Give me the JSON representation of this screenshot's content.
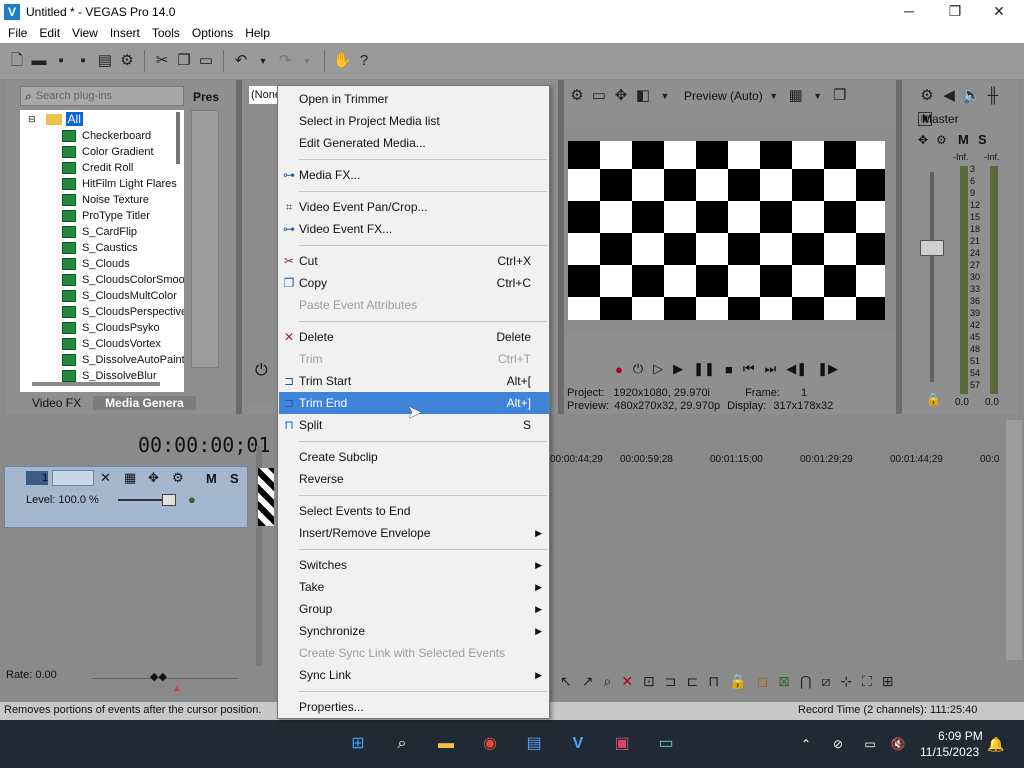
{
  "window": {
    "title": "Untitled * - VEGAS Pro 14.0",
    "logo_glyph": "V",
    "minimize": "─",
    "maximize": "❐",
    "close": "✕"
  },
  "menu": [
    "File",
    "Edit",
    "View",
    "Insert",
    "Tools",
    "Options",
    "Help"
  ],
  "plugins": {
    "search_placeholder": "Search plug-ins",
    "presets_label": "Pres",
    "root": "All",
    "items": [
      "Checkerboard",
      "Color Gradient",
      "Credit Roll",
      "HitFilm Light Flares",
      "Noise Texture",
      "ProType Titler",
      "S_CardFlip",
      "S_Caustics",
      "S_Clouds",
      "S_CloudsColorSmooth",
      "S_CloudsMultColor",
      "S_CloudsPerspective",
      "S_CloudsPsyko",
      "S_CloudsVortex",
      "S_DissolveAutoPaint",
      "S_DissolveBlur"
    ],
    "tabs": [
      "Video FX",
      "Media Genera"
    ]
  },
  "trimmer": {
    "dropdown": "(None"
  },
  "preview": {
    "label": "Preview (Auto)",
    "project_label": "Project:",
    "project_value": "1920x1080, 29.970i",
    "preview_label": "Preview:",
    "preview_value": "480x270x32, 29.970p",
    "frame_label": "Frame:",
    "frame_value": "1",
    "display_label": "Display:",
    "display_value": "317x178x32"
  },
  "master": {
    "label": "Master",
    "mute": "M",
    "solo": "S",
    "inf_left": "-Inf.",
    "inf_right": "-Inf.",
    "scale": [
      "3",
      "6",
      "9",
      "12",
      "15",
      "18",
      "21",
      "24",
      "27",
      "30",
      "33",
      "36",
      "39",
      "42",
      "45",
      "48",
      "51",
      "54",
      "57"
    ],
    "val_left": "0.0",
    "val_right": "0.0"
  },
  "timeline": {
    "timecode": "00:00:00;01",
    "track_number": "1",
    "mute": "M",
    "solo": "S",
    "level": "Level: 100.0 %",
    "ruler": [
      "00:00:44;29",
      "00:00:59;28",
      "00:01:15;00",
      "00:01:29;29",
      "00:01:44;29",
      "00:0"
    ],
    "rate": "Rate: 0.00"
  },
  "context_menu": {
    "items": [
      {
        "label": "Open in Trimmer",
        "shortcut": "",
        "icon": "",
        "disabled": false,
        "submenu": false,
        "highlight": false
      },
      {
        "label": "Select in Project Media list",
        "shortcut": "",
        "icon": "",
        "disabled": false,
        "submenu": false,
        "highlight": false
      },
      {
        "label": "Edit Generated Media...",
        "shortcut": "",
        "icon": "",
        "disabled": false,
        "submenu": false,
        "highlight": false
      },
      {
        "sep": true
      },
      {
        "label": "Media FX...",
        "shortcut": "",
        "icon": "media-fx-icon",
        "disabled": false,
        "submenu": false,
        "highlight": false
      },
      {
        "sep": true
      },
      {
        "label": "Video Event Pan/Crop...",
        "shortcut": "",
        "icon": "crop-icon",
        "disabled": false,
        "submenu": false,
        "highlight": false
      },
      {
        "label": "Video Event FX...",
        "shortcut": "",
        "icon": "event-fx-icon",
        "disabled": false,
        "submenu": false,
        "highlight": false
      },
      {
        "sep": true
      },
      {
        "label": "Cut",
        "shortcut": "Ctrl+X",
        "icon": "scissors-icon",
        "disabled": false,
        "submenu": false,
        "highlight": false
      },
      {
        "label": "Copy",
        "shortcut": "Ctrl+C",
        "icon": "copy-icon",
        "disabled": false,
        "submenu": false,
        "highlight": false
      },
      {
        "label": "Paste Event Attributes",
        "shortcut": "",
        "icon": "",
        "disabled": true,
        "submenu": false,
        "highlight": false
      },
      {
        "sep": true
      },
      {
        "label": "Delete",
        "shortcut": "Delete",
        "icon": "delete-x-icon",
        "disabled": false,
        "submenu": false,
        "highlight": false
      },
      {
        "label": "Trim",
        "shortcut": "Ctrl+T",
        "icon": "",
        "disabled": true,
        "submenu": false,
        "highlight": false
      },
      {
        "label": "Trim Start",
        "shortcut": "Alt+[",
        "icon": "trim-start-icon",
        "disabled": false,
        "submenu": false,
        "highlight": false
      },
      {
        "label": "Trim End",
        "shortcut": "Alt+]",
        "icon": "trim-end-icon",
        "disabled": false,
        "submenu": false,
        "highlight": true
      },
      {
        "label": "Split",
        "shortcut": "S",
        "icon": "split-icon",
        "disabled": false,
        "submenu": false,
        "highlight": false
      },
      {
        "sep": true
      },
      {
        "label": "Create Subclip",
        "shortcut": "",
        "icon": "",
        "disabled": false,
        "submenu": false,
        "highlight": false
      },
      {
        "label": "Reverse",
        "shortcut": "",
        "icon": "",
        "disabled": false,
        "submenu": false,
        "highlight": false
      },
      {
        "sep": true
      },
      {
        "label": "Select Events to End",
        "shortcut": "",
        "icon": "",
        "disabled": false,
        "submenu": false,
        "highlight": false
      },
      {
        "label": "Insert/Remove Envelope",
        "shortcut": "",
        "icon": "",
        "disabled": false,
        "submenu": true,
        "highlight": false
      },
      {
        "sep": true
      },
      {
        "label": "Switches",
        "shortcut": "",
        "icon": "",
        "disabled": false,
        "submenu": true,
        "highlight": false
      },
      {
        "label": "Take",
        "shortcut": "",
        "icon": "",
        "disabled": false,
        "submenu": true,
        "highlight": false
      },
      {
        "label": "Group",
        "shortcut": "",
        "icon": "",
        "disabled": false,
        "submenu": true,
        "highlight": false
      },
      {
        "label": "Synchronize",
        "shortcut": "",
        "icon": "",
        "disabled": false,
        "submenu": true,
        "highlight": false
      },
      {
        "label": "Create Sync Link with Selected Events",
        "shortcut": "",
        "icon": "",
        "disabled": true,
        "submenu": false,
        "highlight": false
      },
      {
        "label": "Sync Link",
        "shortcut": "",
        "icon": "",
        "disabled": false,
        "submenu": true,
        "highlight": false
      },
      {
        "sep": true
      },
      {
        "label": "Properties...",
        "shortcut": "",
        "icon": "",
        "disabled": false,
        "submenu": false,
        "highlight": false
      }
    ]
  },
  "status": {
    "text": "Removes portions of events after the cursor position.",
    "record_time": "Record Time (2 channels): 111:25:40"
  },
  "taskbar": {
    "time": "6:09 PM",
    "date": "11/15/2023"
  },
  "colors": {
    "menu_highlight": "#3f84d8",
    "panel_bg": "#8f8f8f",
    "track_header": "#a4b7cf"
  }
}
